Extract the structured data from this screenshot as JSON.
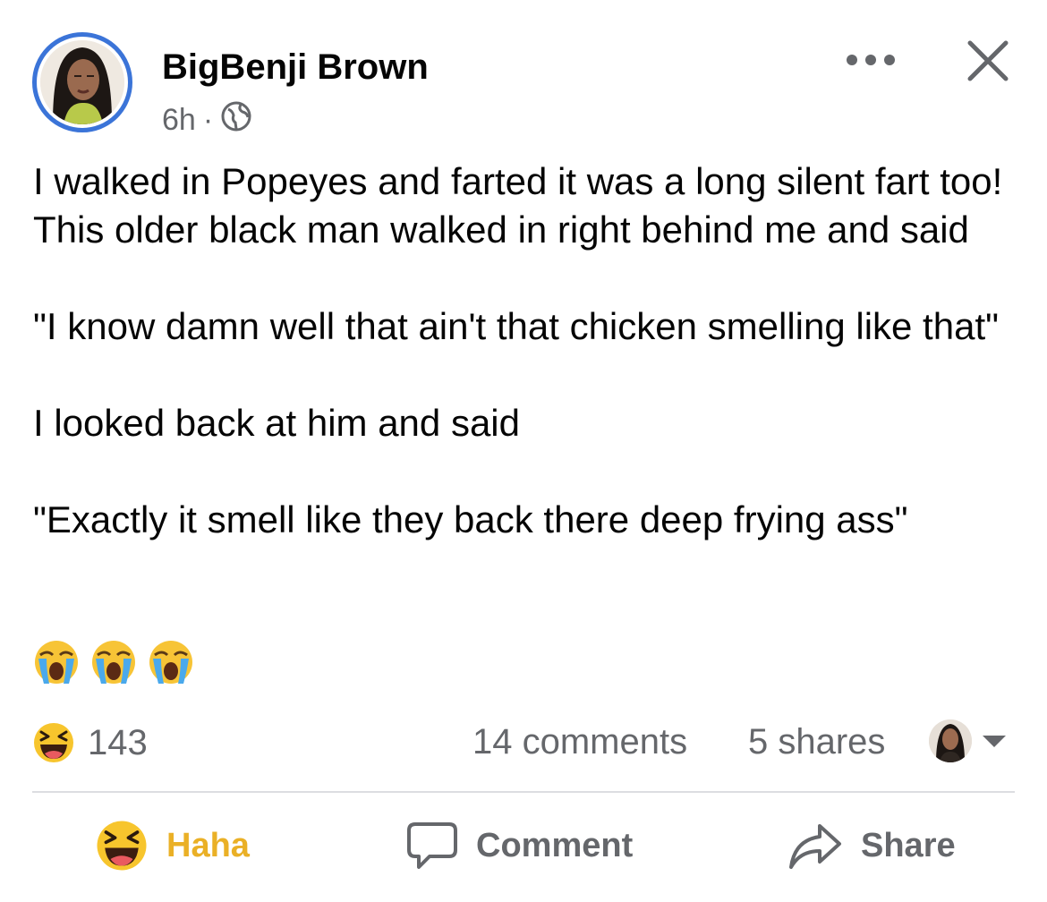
{
  "post": {
    "author": "BigBenji Brown",
    "time": "6h",
    "separator": "·",
    "audience_icon": "globe-icon",
    "paragraphs": [
      "I walked in Popeyes and farted it was a long silent fart too! This older black man walked in right behind me and said",
      "\"I know damn well that ain't that chicken smelling like that\"",
      "I looked back at him and said",
      "\"Exactly it smell like they back there deep frying ass\""
    ],
    "trailing_emojis": [
      "loudly-crying-face",
      "loudly-crying-face",
      "loudly-crying-face"
    ]
  },
  "stats": {
    "reaction_icon": "haha-reaction-icon",
    "reactions": "143",
    "comments": "14 comments",
    "shares": "5 shares"
  },
  "actions": {
    "haha": "Haha",
    "comment": "Comment",
    "share": "Share"
  },
  "colors": {
    "avatar_ring": "#3b74d8",
    "haha_active": "#eab026",
    "secondary_text": "#65676b",
    "divider": "#dcdde1"
  }
}
